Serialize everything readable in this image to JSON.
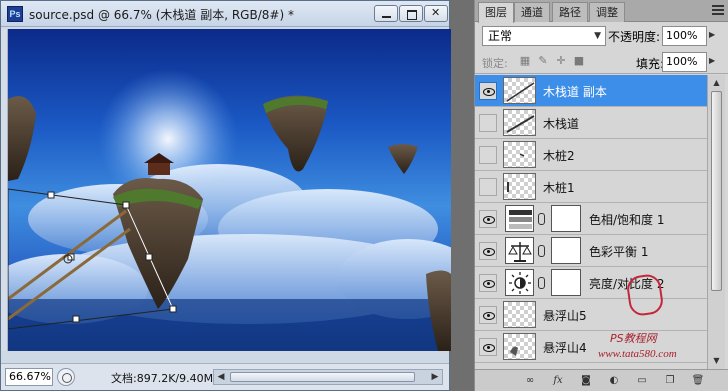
{
  "doc_window": {
    "app_icon_label": "Ps",
    "title": "source.psd @ 66.7% (木栈道 副本, RGB/8#) *",
    "zoom": "66.67%",
    "doc_info": "文档:897.2K/9.40M"
  },
  "layers_panel": {
    "tabs": [
      {
        "label": "图层",
        "active": true
      },
      {
        "label": "通道",
        "active": false
      },
      {
        "label": "路径",
        "active": false
      },
      {
        "label": "调整",
        "active": false
      }
    ],
    "blend_mode": "正常",
    "opacity_label": "不透明度:",
    "opacity_value": "100%",
    "lock_label": "锁定:",
    "fill_label": "填充:",
    "fill_value": "100%",
    "layers": [
      {
        "name": "木栈道 副本",
        "visible": true,
        "selected": true,
        "kind": "pixel"
      },
      {
        "name": "木栈道",
        "visible": false,
        "selected": false,
        "kind": "pixel"
      },
      {
        "name": "木桩2",
        "visible": false,
        "selected": false,
        "kind": "pixel"
      },
      {
        "name": "木桩1",
        "visible": false,
        "selected": false,
        "kind": "pixel"
      },
      {
        "name": "色相/饱和度 1",
        "visible": true,
        "selected": false,
        "kind": "adjustment",
        "icon": "hue-saturation-icon"
      },
      {
        "name": "色彩平衡 1",
        "visible": true,
        "selected": false,
        "kind": "adjustment",
        "icon": "color-balance-icon"
      },
      {
        "name": "亮度/对比度 2",
        "visible": true,
        "selected": false,
        "kind": "adjustment",
        "icon": "brightness-contrast-icon"
      },
      {
        "name": "悬浮山5",
        "visible": true,
        "selected": false,
        "kind": "pixel"
      },
      {
        "name": "悬浮山4",
        "visible": true,
        "selected": false,
        "kind": "pixel"
      }
    ],
    "footer_icons": [
      "link-layers-icon",
      "fx-icon",
      "add-mask-icon",
      "adjustment-icon",
      "group-icon",
      "new-layer-icon",
      "trash-icon"
    ]
  },
  "watermark": {
    "url": "www.tata580.com",
    "site": "PS教程网"
  },
  "colors": {
    "selection": "#3d8ee9",
    "panel_bg": "#d6d6d6",
    "doc_frame": "#cfd9e6"
  }
}
